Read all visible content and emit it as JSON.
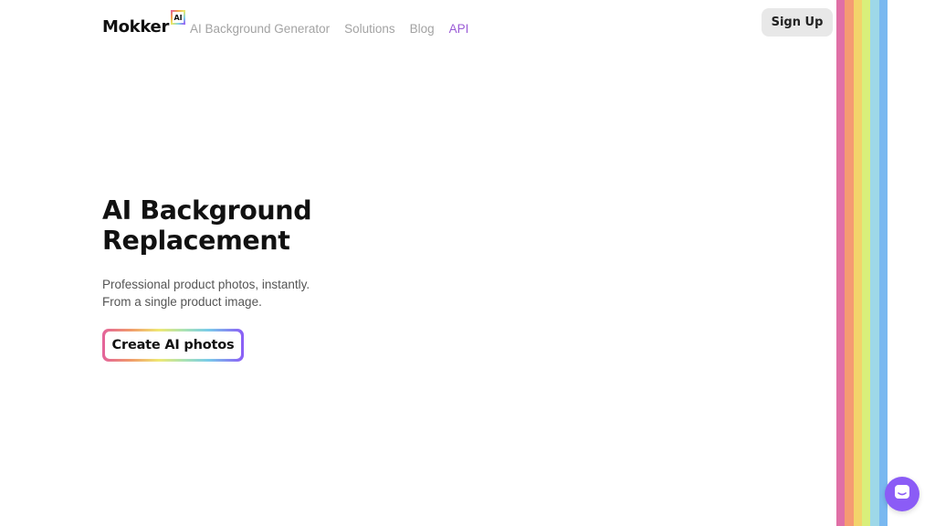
{
  "header": {
    "logo_text": "Mokker",
    "logo_badge": "AI",
    "nav": [
      {
        "label": "AI Background Generator"
      },
      {
        "label": "Solutions"
      },
      {
        "label": "Blog"
      },
      {
        "label": "API"
      }
    ],
    "signup_label": "Sign Up"
  },
  "hero": {
    "title_line1": "AI Background",
    "title_line2": "Replacement",
    "subtitle_line1": "Professional product photos, instantly.",
    "subtitle_line2": "From a single product image.",
    "cta_label": "Create AI photos"
  },
  "decor": {
    "stripe_colors": [
      "#e06fa6",
      "#f59b72",
      "#f3d36b",
      "#d9ef7a",
      "#9ed8e8",
      "#79b8f0",
      "#8f5cf5"
    ]
  },
  "chat_widget": {
    "icon": "chat-bubble-icon",
    "color": "#8b5cf6"
  },
  "colors": {
    "accent": "#9b5cd6",
    "highlight": "#f7eab8"
  }
}
